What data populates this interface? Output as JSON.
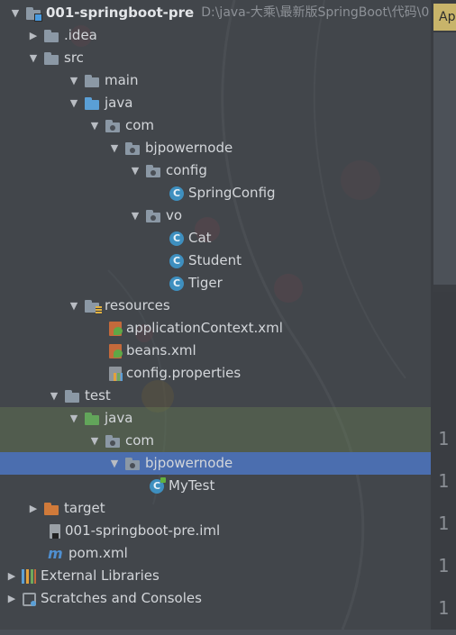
{
  "editor": {
    "tab_label": "Ap",
    "line_numbers": [
      "1",
      "1",
      "1",
      "1",
      "1"
    ]
  },
  "tree": {
    "project": {
      "name": "001-springboot-pre",
      "path": "D:\\java-大乘\\最新版SpringBoot\\代码\\0"
    },
    "idea": ".idea",
    "src": "src",
    "main": "main",
    "java_main": "java",
    "com_main": "com",
    "bjpowernode_main": "bjpowernode",
    "config": "config",
    "spring_config": "SpringConfig",
    "vo": "vo",
    "cat": "Cat",
    "student": "Student",
    "tiger": "Tiger",
    "resources": "resources",
    "application_context_xml": "applicationContext.xml",
    "beans_xml": "beans.xml",
    "config_properties": "config.properties",
    "test": "test",
    "java_test": "java",
    "com_test": "com",
    "bjpowernode_test": "bjpowernode",
    "my_test": "MyTest",
    "target": "target",
    "iml_file": "001-springboot-pre.iml",
    "pom": "pom.xml",
    "external_libraries": "External Libraries",
    "scratches": "Scratches and Consoles",
    "icons": {
      "class": "C",
      "maven": "m"
    }
  },
  "colors": {
    "selection": "#4b6eaf",
    "test_band": "#6e8755",
    "source_folder": "#5a9fd6",
    "test_folder": "#62a55a",
    "excluded_folder": "#d07a3a"
  }
}
